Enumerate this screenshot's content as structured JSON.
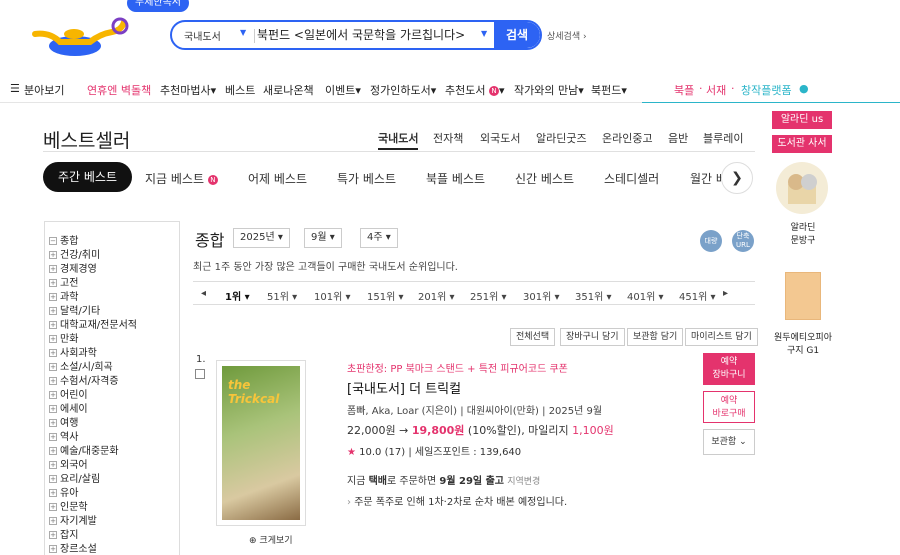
{
  "colors": {
    "brand_blue": "#2d63f3",
    "pink": "#e4336d",
    "teal": "#2bb5c9"
  },
  "header": {
    "free_badge": "무제한독서",
    "search": {
      "category": "국내도서",
      "value": "북펀드 <일본에서 국문학을 가르칩니다>",
      "button": "검색"
    },
    "advanced_search": "상세검색 ›"
  },
  "nav": {
    "menu": "분아보기",
    "items": [
      "연휴엔 벽돌책",
      "추천마법사▾",
      "베스트",
      "새로나온책",
      "이벤트▾",
      "정가인하도서▾",
      "추천도서",
      "▾",
      "작가와의 만남▾",
      "북펀드▾"
    ],
    "right": [
      "북플",
      "서재",
      "창작플랫폼"
    ]
  },
  "rail": {
    "btn1": "알라딘 us",
    "btn2": "도서관 사서",
    "cat_label": "알라딘\n문방구",
    "book_label": "원두에티오피아\n구지 G1"
  },
  "page": {
    "title": "베스트셀러",
    "cat_tabs": [
      "국내도서",
      "전자책",
      "외국도서",
      "알라딘굿즈",
      "온라인중고",
      "음반",
      "블루레이"
    ],
    "pill": "주간 베스트",
    "sub_tabs": [
      "지금 베스트",
      "어제 베스트",
      "특가 베스트",
      "북플 베스트",
      "신간 베스트",
      "스테디셀러",
      "월간 베"
    ]
  },
  "sidebar": {
    "items": [
      "종합",
      "건강/취미",
      "경제경영",
      "고전",
      "과학",
      "달력/기타",
      "대학교재/전문서적",
      "만화",
      "사회과학",
      "소설/시/희곡",
      "수험서/자격증",
      "어린이",
      "에세이",
      "여행",
      "역사",
      "예술/대중문화",
      "외국어",
      "요리/살림",
      "유아",
      "인문학",
      "자기계발",
      "잡지",
      "장르소설"
    ]
  },
  "main": {
    "title": "종합",
    "year": "2025년",
    "month": "9월",
    "week": "4주",
    "icons": [
      "대량",
      "단축URL"
    ],
    "desc": "최근 1주 동안 가장 많은 고객들이 구매한 국내도서 순위입니다.",
    "ranks": [
      "1위",
      "51위",
      "101위",
      "151위",
      "201위",
      "251위",
      "301위",
      "351위",
      "401위",
      "451위"
    ],
    "actions": [
      "전체선택",
      "장바구니 담기",
      "보관함 담기",
      "마이리스트 담기"
    ]
  },
  "book": {
    "rank": "1.",
    "promo": "초판한정: PP 북마크 스탠드 + 특전 피규어코드 쿠폰",
    "category": "[국내도서]",
    "title": "더 트릭컬",
    "cover_text": "the Trickcal",
    "meta": "폼빠, Aka, Loar (지은이) | 대원씨아이(만화) | 2025년 9월",
    "price_orig": "22,000원",
    "price_sale": "19,800원",
    "discount": "(10%할인)",
    "mileage": ", 마일리지",
    "mileage_val": "1,100원",
    "rating": "10.0",
    "reviews": "(17)",
    "sales_point": "| 세일즈포인트 : 139,640",
    "ship_prefix": "지금 ",
    "ship_method": "택배",
    "ship_mid": "로 주문하면 ",
    "ship_date": "9월 29일 출고",
    "ship_region": "지역변경",
    "note": "주문 폭주로 인해 1차·2차로 순차 배본 예정입니다.",
    "btn_cart": "예약\n장바구니",
    "btn_buy": "예약\n바로구매",
    "btn_keep": "보관함",
    "zoom": "크게보기"
  }
}
